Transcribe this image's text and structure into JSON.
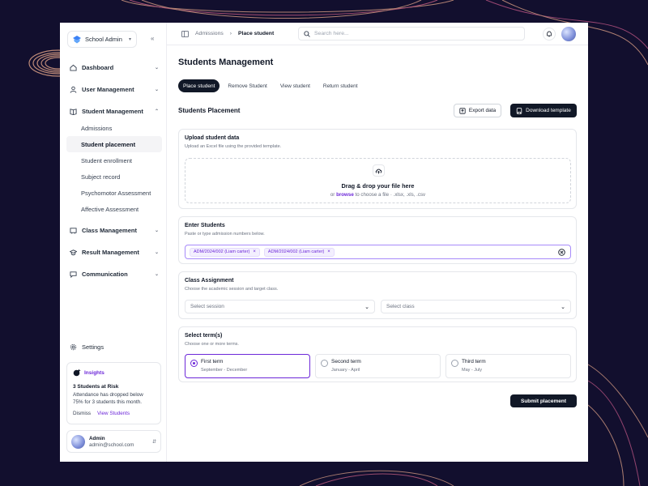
{
  "sidebar": {
    "brand": "School Admin",
    "nav": [
      {
        "label": "Dashboard"
      },
      {
        "label": "User Management"
      },
      {
        "label": "Student Management"
      },
      {
        "label": "Class Management"
      },
      {
        "label": "Result Management"
      },
      {
        "label": "Communication"
      }
    ],
    "student_sub": [
      "Admissions",
      "Student placement",
      "Student enrollment",
      "Subject record",
      "Psychomotor Assessment",
      "Affective Assessment"
    ],
    "settings": "Settings",
    "insight": {
      "tag": "Insights",
      "title": "3 Students at Risk",
      "text": "Attendance has dropped below 75% for 3 students this month.",
      "dismiss": "Dismiss",
      "view": "View Students"
    },
    "user": {
      "name": "Admin",
      "email": "admin@school.com"
    }
  },
  "topbar": {
    "crumb_parent": "Admissions",
    "crumb_current": "Place student",
    "search_placeholder": "Search here..."
  },
  "main": {
    "title": "Students Management",
    "tabs": [
      "Place student",
      "Remove Student",
      "View student",
      "Return student"
    ],
    "section_title": "Students Placement",
    "export_label": "Export data",
    "download_label": "Download template",
    "upload": {
      "title": "Upload student data",
      "subtitle": "Upload an Excel file using the provided template.",
      "drop_title": "Drag & drop your file here",
      "or": "or",
      "browse": "browse",
      "drop_hint": "to choose a file · .xlsx, .xls, .csv"
    },
    "students": {
      "title": "Enter Students",
      "subtitle": "Paste or type admission numbers below.",
      "chips": [
        "ADM/2024/002 (Liam carter)",
        "ADM/2024/002 (Liam carter)"
      ]
    },
    "classes": {
      "title": "Class Assignment",
      "subtitle": "Choose the academic session and target class.",
      "session_placeholder": "Select session",
      "class_placeholder": "Select class"
    },
    "terms": {
      "title": "Select term(s)",
      "subtitle": "Choose one or more terms.",
      "items": [
        {
          "name": "First term",
          "dates": "September - December"
        },
        {
          "name": "Second term",
          "dates": "January - April"
        },
        {
          "name": "Third term",
          "dates": "May - July"
        }
      ]
    },
    "submit_label": "Submit placement"
  },
  "colors": {
    "accent": "#6d28d9",
    "dark": "#111827",
    "background": "#120f2e"
  }
}
